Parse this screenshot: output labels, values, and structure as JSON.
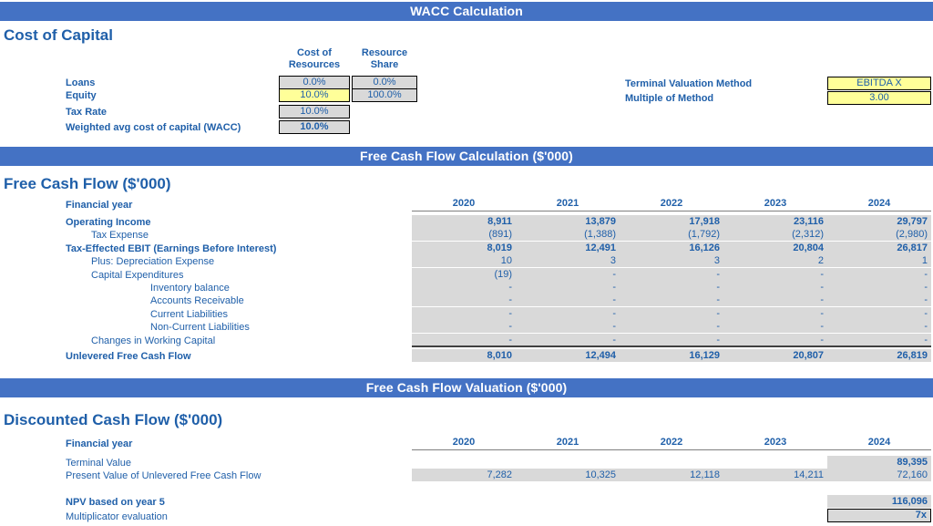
{
  "banners": {
    "wacc": "WACC Calculation",
    "fcf_calc": "Free Cash Flow Calculation ($'000)",
    "fcf_val": "Free Cash Flow Valuation ($'000)"
  },
  "cost_of_capital": {
    "title": "Cost of Capital",
    "col_headers": [
      "Cost of Resources",
      "Resource Share"
    ],
    "col_header_lines": [
      [
        "Cost of",
        "Resources"
      ],
      [
        "Resource",
        "Share"
      ]
    ],
    "rows": [
      {
        "label": "Loans",
        "cost": "0.0%",
        "share": "0.0%"
      },
      {
        "label": "Equity",
        "cost": "10.0%",
        "share": "100.0%"
      },
      {
        "label": "Tax Rate",
        "cost": "10.0%",
        "share": ""
      },
      {
        "label": "Weighted avg cost of capital (WACC)",
        "cost": "10.0%",
        "share": ""
      }
    ]
  },
  "terminal": {
    "rows": [
      {
        "label": "Terminal Valuation Method",
        "value": "EBITDA X"
      },
      {
        "label": "Multiple of Method",
        "value": "3.00"
      }
    ]
  },
  "free_cash_flow": {
    "title": "Free Cash Flow ($'000)",
    "year_label": "Financial year",
    "years": [
      "2020",
      "2021",
      "2022",
      "2023",
      "2024"
    ],
    "rows": [
      {
        "label": "Operating Income",
        "indent": 0,
        "bold": true,
        "values": [
          "8,911",
          "13,879",
          "17,918",
          "23,116",
          "29,797"
        ]
      },
      {
        "label": "Tax Expense",
        "indent": 1,
        "bold": false,
        "values": [
          "(891)",
          "(1,388)",
          "(1,792)",
          "(2,312)",
          "(2,980)"
        ]
      },
      {
        "label": "Tax-Effected EBIT (Earnings Before Interest)",
        "indent": 0,
        "bold": true,
        "values": [
          "8,019",
          "12,491",
          "16,126",
          "20,804",
          "26,817"
        ]
      },
      {
        "label": "Plus: Depreciation Expense",
        "indent": 1,
        "bold": false,
        "values": [
          "10",
          "3",
          "3",
          "2",
          "1"
        ]
      },
      {
        "label": "Capital Expenditures",
        "indent": 1,
        "bold": false,
        "values": [
          "(19)",
          "-",
          "-",
          "-",
          "-"
        ]
      },
      {
        "label": "Inventory balance",
        "indent": 2,
        "bold": false,
        "values": [
          "-",
          "-",
          "-",
          "-",
          "-"
        ]
      },
      {
        "label": "Accounts Receivable",
        "indent": 2,
        "bold": false,
        "values": [
          "-",
          "-",
          "-",
          "-",
          "-"
        ]
      },
      {
        "label": "Current Liabilities",
        "indent": 2,
        "bold": false,
        "values": [
          "-",
          "-",
          "-",
          "-",
          "-"
        ]
      },
      {
        "label": "Non-Current Liabilities",
        "indent": 2,
        "bold": false,
        "values": [
          "-",
          "-",
          "-",
          "-",
          "-"
        ]
      },
      {
        "label": "Changes in Working Capital",
        "indent": 1,
        "bold": false,
        "values": [
          "-",
          "-",
          "-",
          "-",
          "-"
        ]
      }
    ],
    "total_row": {
      "label": "Unlevered Free Cash Flow",
      "values": [
        "8,010",
        "12,494",
        "16,129",
        "20,807",
        "26,819"
      ]
    }
  },
  "discounted_cash_flow": {
    "title": "Discounted Cash Flow ($'000)",
    "year_label": "Financial year",
    "years": [
      "2020",
      "2021",
      "2022",
      "2023",
      "2024"
    ],
    "terminal_value": {
      "label": "Terminal Value",
      "values": [
        "",
        "",
        "",
        "",
        "89,395"
      ]
    },
    "pv_row": {
      "label": "Present Value of Unlevered Free Cash Flow",
      "values": [
        "7,282",
        "10,325",
        "12,118",
        "14,211",
        "72,160"
      ]
    },
    "npv_row": {
      "label": "NPV based on year 5",
      "values": [
        "",
        "",
        "",
        "",
        "116,096"
      ]
    },
    "multiplicator_row": {
      "label": "Multiplicator evaluation",
      "values": [
        "",
        "",
        "",
        "",
        "7x"
      ]
    }
  },
  "colors": {
    "banner_blue": "#4472C4",
    "text_blue": "#1F5FA9",
    "cell_gray": "#D9D9D9",
    "input_yellow": "#FFFF99"
  }
}
